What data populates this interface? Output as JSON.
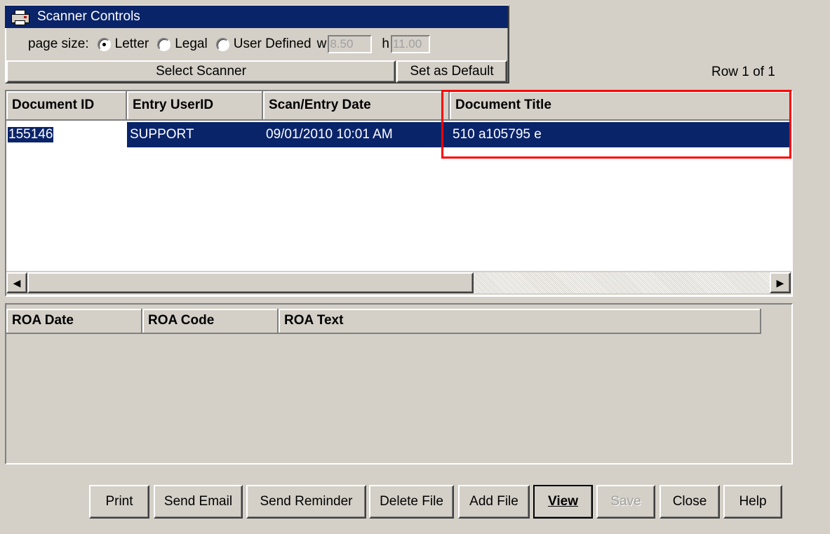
{
  "scanner": {
    "title": "Scanner Controls",
    "page_size_label": "page size:",
    "options": [
      "Letter",
      "Legal",
      "User Defined"
    ],
    "selected_option": "Letter",
    "w_label": "w",
    "w_value": "8.50",
    "h_label": "h",
    "h_value": "11.00",
    "select_scanner_label": "Select Scanner",
    "set_default_label": "Set as Default"
  },
  "row_count": "Row 1 of 1",
  "documents": {
    "columns": [
      "Document ID",
      "Entry UserID",
      "Scan/Entry Date",
      "Document Title"
    ],
    "rows": [
      [
        "155146",
        "SUPPORT",
        "09/01/2010 10:01 AM",
        "510 a105795 e"
      ]
    ],
    "selected_color": "#0a246a",
    "highlight_color": "#ff0000"
  },
  "roa": {
    "columns": [
      "ROA Date",
      "ROA Code",
      "ROA Text"
    ]
  },
  "buttons": {
    "print": "Print",
    "send_email": "Send Email",
    "send_reminder": "Send Reminder",
    "delete_file": "Delete File",
    "add_file": "Add File",
    "view": "View",
    "save": "Save",
    "close": "Close",
    "help": "Help"
  }
}
